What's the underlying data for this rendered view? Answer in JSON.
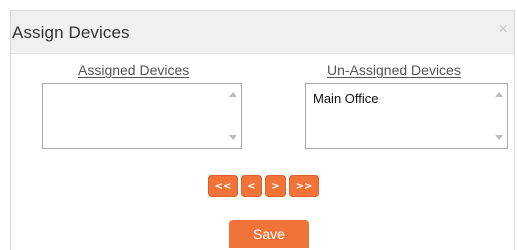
{
  "dialog": {
    "title": "Assign Devices",
    "close_glyph": "×"
  },
  "assigned": {
    "label": "Assigned Devices",
    "items": []
  },
  "unassigned": {
    "label": "Un-Assigned Devices",
    "items": [
      "Main Office"
    ]
  },
  "move_buttons": {
    "all_left": "<<",
    "left": "<",
    "right": ">",
    "all_right": ">>"
  },
  "save_label": "Save",
  "colors": {
    "accent": "#f0743a",
    "header_bg": "#f0f0f0"
  },
  "icons": [
    "close-icon",
    "scroll-up-icon",
    "scroll-down-icon"
  ]
}
